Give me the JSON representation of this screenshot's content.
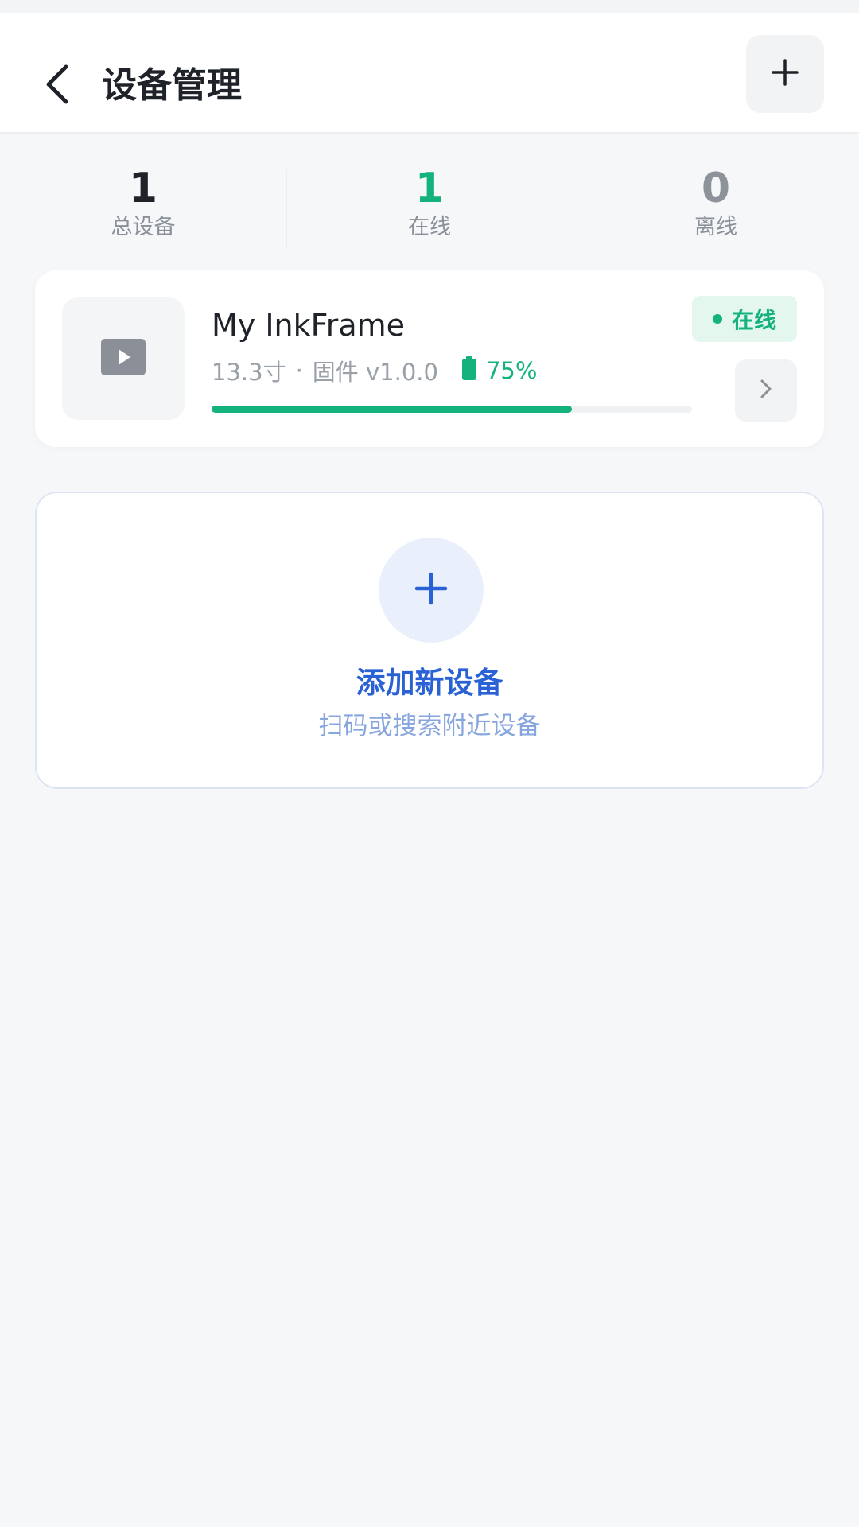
{
  "header": {
    "back_icon": "chevron-left-icon",
    "title": "设备管理",
    "add_icon": "plus-icon"
  },
  "stats": [
    {
      "value": "1",
      "label": "总设备",
      "color": "#1f2329"
    },
    {
      "value": "1",
      "label": "在线",
      "color": "#14b37d"
    },
    {
      "value": "0",
      "label": "离线",
      "color": "#8e939b"
    }
  ],
  "device": {
    "name": "My InkFrame",
    "size": "13.3寸",
    "separator": "·",
    "firmware": "固件 v1.0.0",
    "battery_text": "75%",
    "battery_level": 0.75,
    "status": "在线",
    "thumb_icon": "play-icon",
    "detail_icon": "chevron-right-icon"
  },
  "add_device": {
    "icon": "plus-icon",
    "title": "添加新设备",
    "subtitle": "扫码或搜索附近设备"
  },
  "colors": {
    "accent_green": "#14b37d",
    "accent_blue": "#2a62d6",
    "background": "#f6f7f9"
  }
}
